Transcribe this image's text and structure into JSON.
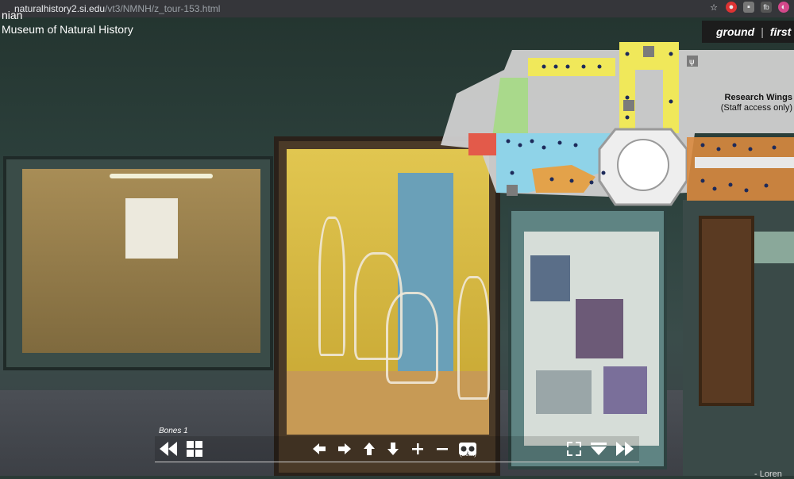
{
  "browser": {
    "url_host": "naturalhistory2.si.edu",
    "url_path": "/vt3/NMNH/z_tour-153.html"
  },
  "header": {
    "line1": "nian",
    "line2": "Museum of Natural History"
  },
  "map": {
    "floor_ground": "ground",
    "floor_first": "first",
    "research_title": "Research Wings",
    "research_sub": "(Staff access only)"
  },
  "toolbar": {
    "scene_label": "Bones 1",
    "beta_label": "(beta)"
  },
  "footer": {
    "credit": "- Loren"
  },
  "colors": {
    "map_yellow": "#f0e85a",
    "map_blue": "#8fd3e8",
    "map_green": "#a9d98b",
    "map_orange": "#e3a24a",
    "map_gray": "#cfcfcf"
  }
}
